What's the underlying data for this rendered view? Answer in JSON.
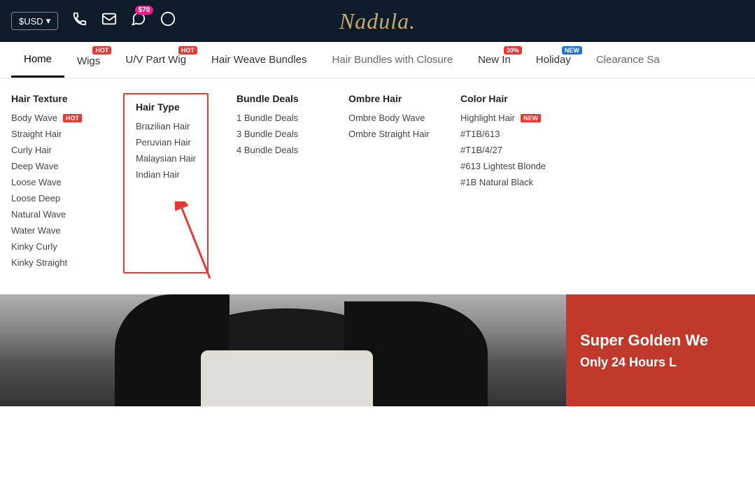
{
  "topbar": {
    "currency": "$USD",
    "currency_arrow": "▾",
    "badge_amount": "$70",
    "logo": "Nadula."
  },
  "nav": {
    "items": [
      {
        "id": "home",
        "label": "Home",
        "active": true,
        "badge": null
      },
      {
        "id": "wigs",
        "label": "Wigs",
        "active": false,
        "badge": "HOT",
        "badge_type": "hot"
      },
      {
        "id": "uv-part-wig",
        "label": "U/V Part Wig",
        "active": false,
        "badge": "HOT",
        "badge_type": "hot"
      },
      {
        "id": "hair-weave-bundles",
        "label": "Hair Weave Bundles",
        "active": false,
        "badge": null
      },
      {
        "id": "hair-bundles-closure",
        "label": "Hair Bundles with Closure",
        "active": false,
        "badge": null
      },
      {
        "id": "new-in",
        "label": "New In",
        "active": false,
        "badge": "30%",
        "badge_type": "pct"
      },
      {
        "id": "holiday",
        "label": "Holiday",
        "active": false,
        "badge": "NEW",
        "badge_type": "new"
      },
      {
        "id": "clearance",
        "label": "Clearance Sa",
        "active": false,
        "badge": null
      }
    ]
  },
  "dropdown": {
    "hair_texture": {
      "header": "Hair Texture",
      "items": [
        {
          "label": "Body Wave",
          "badge": "HOT"
        },
        {
          "label": "Straight Hair",
          "badge": null
        },
        {
          "label": "Curly Hair",
          "badge": null
        },
        {
          "label": "Deep Wave",
          "badge": null
        },
        {
          "label": "Loose Wave",
          "badge": null
        },
        {
          "label": "Loose Deep",
          "badge": null
        },
        {
          "label": "Natural Wave",
          "badge": null
        },
        {
          "label": "Water Wave",
          "badge": null
        },
        {
          "label": "Kinky Curly",
          "badge": null
        },
        {
          "label": "Kinky Straight",
          "badge": null
        }
      ]
    },
    "hair_type": {
      "header": "Hair Type",
      "items": [
        {
          "label": "Brazilian Hair"
        },
        {
          "label": "Peruvian Hair"
        },
        {
          "label": "Malaysian Hair"
        },
        {
          "label": "Indian Hair"
        }
      ]
    },
    "bundle_deals": {
      "header": "Bundle Deals",
      "items": [
        {
          "label": "1 Bundle Deals"
        },
        {
          "label": "3 Bundle Deals"
        },
        {
          "label": "4 Bundle Deals"
        }
      ]
    },
    "ombre_hair": {
      "header": "Ombre Hair",
      "items": [
        {
          "label": "Ombre Body Wave"
        },
        {
          "label": "Ombre Straight Hair"
        }
      ]
    },
    "color_hair": {
      "header": "Color Hair",
      "items": [
        {
          "label": "Highlight Hair",
          "badge": "NEW"
        },
        {
          "label": "#T1B/613"
        },
        {
          "label": "#T1B/4/27"
        },
        {
          "label": "#613 Lightest Blonde"
        },
        {
          "label": "#1B Natural Black"
        }
      ]
    }
  },
  "hero": {
    "title": "Super Golden We",
    "subtitle": "Only 24 Hours L"
  }
}
